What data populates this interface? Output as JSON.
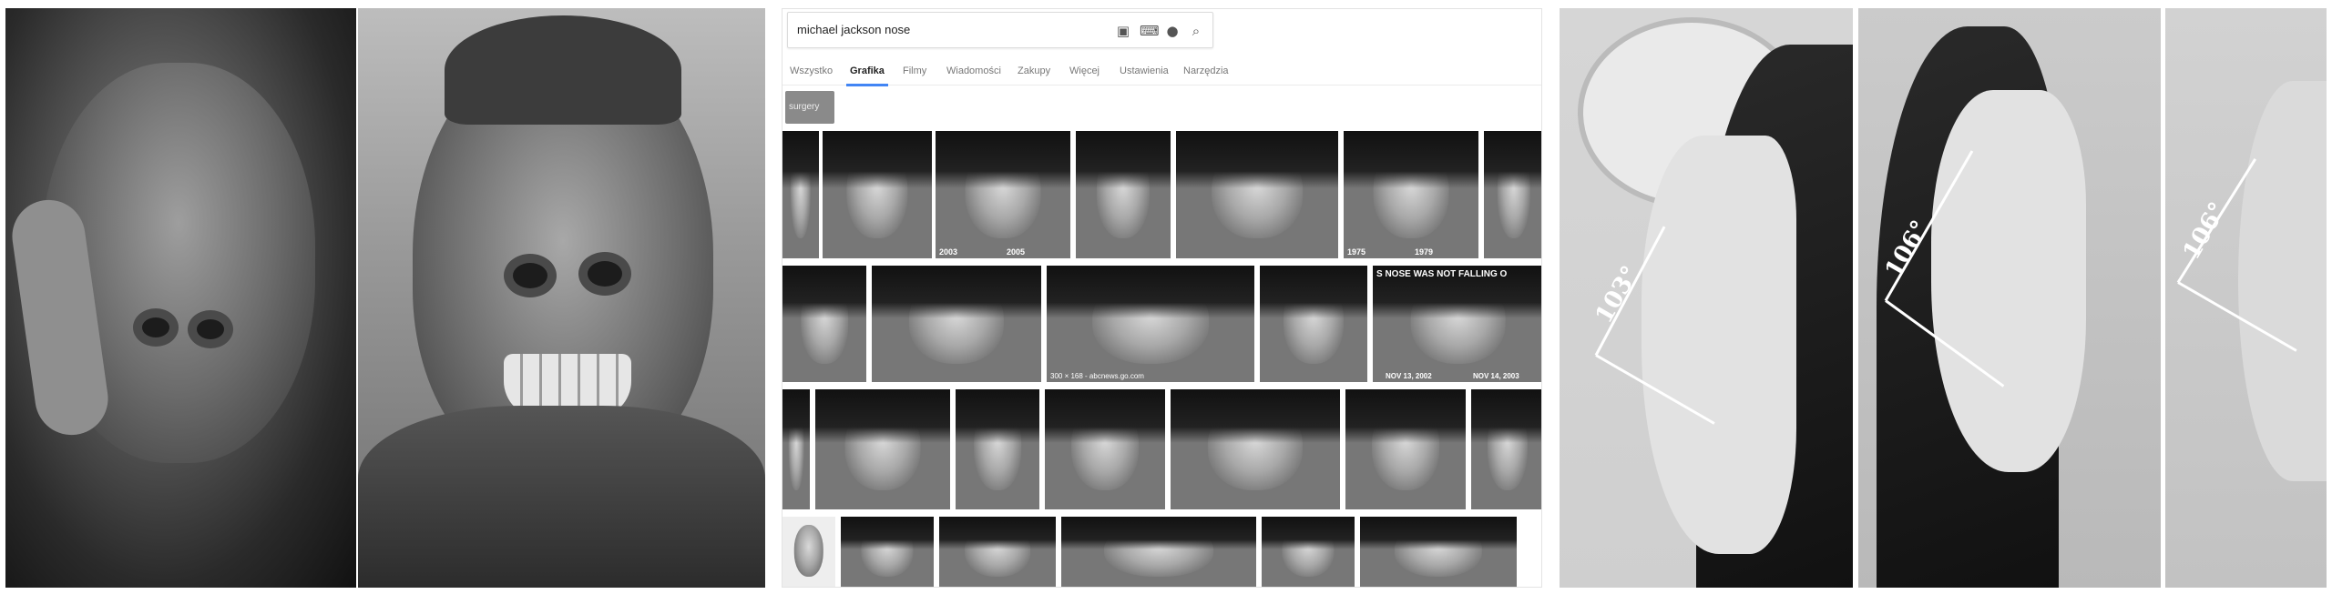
{
  "browser": {
    "search": {
      "query": "michael jackson nose"
    },
    "search_icons": [
      "camera-icon",
      "keyboard-icon",
      "microphone-icon",
      "search-icon"
    ],
    "tabs": [
      {
        "label": "Wszystko",
        "active": false
      },
      {
        "label": "Grafika",
        "active": true
      },
      {
        "label": "Filmy",
        "active": false
      },
      {
        "label": "Wiadomości",
        "active": false
      },
      {
        "label": "Zakupy",
        "active": false
      },
      {
        "label": "Więcej",
        "active": false
      },
      {
        "label": "Ustawienia",
        "active": false
      },
      {
        "label": "Narzędzia",
        "active": false
      }
    ],
    "chip": "surgery",
    "captions": {
      "c2003": "2003",
      "c2005": "2005",
      "c1975": "1975",
      "c1979": "1979",
      "nose_headline": "S NOSE WAS NOT FALLING O",
      "source": "300 × 168 - abcnews.go.com",
      "nov2002": "NOV 13, 2002",
      "nov2003": "NOV 14, 2003"
    }
  },
  "photos": {
    "angle_left": "103°",
    "angle_mid": "106°",
    "angle_right": "106°"
  }
}
